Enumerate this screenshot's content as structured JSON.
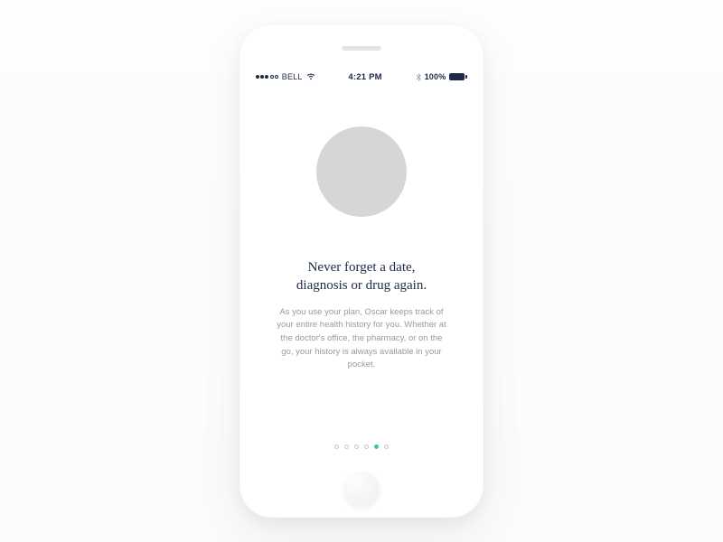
{
  "status_bar": {
    "carrier": "BELL",
    "time": "4:21 PM",
    "battery_percent": "100%",
    "signal_filled_dots": 3,
    "signal_total_dots": 5
  },
  "onboarding": {
    "headline": "Never forget a date,\ndiagnosis or drug again.",
    "body": "As you use your plan, Oscar keeps track of your entire health history for you. Whether at the doctor's office, the pharmacy, or on the go, your history is always available in your pocket.",
    "page_count": 6,
    "active_page_index": 4
  }
}
